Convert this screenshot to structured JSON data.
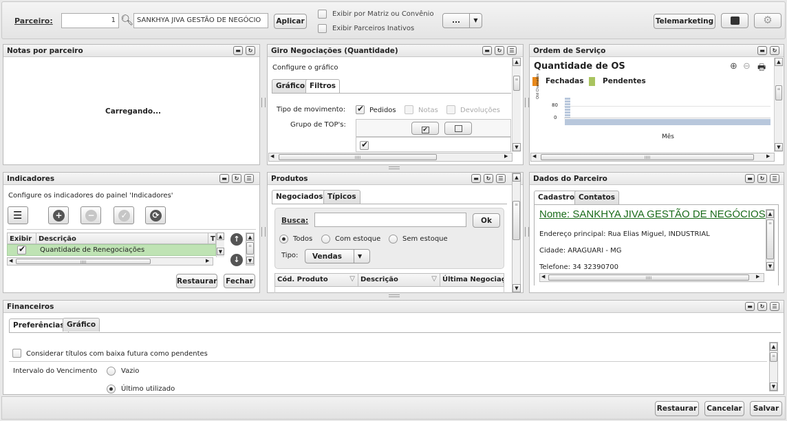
{
  "topbar": {
    "parceiro_label": "Parceiro:",
    "parceiro_code": "1",
    "parceiro_name": "SANKHYA JIVA GESTÃO DE NEGÓCIO",
    "aplicar": "Aplicar",
    "exibir_matriz": "Exibir por Matriz ou Convênio",
    "exibir_inativos": "Exibir Parceiros Inativos",
    "more": "...",
    "telemarketing": "Telemarketing"
  },
  "notas": {
    "title": "Notas por parceiro",
    "loading": "Carregando..."
  },
  "giro": {
    "title": "Giro Negociações (Quantidade)",
    "configure": "Configure o gráfico",
    "tabs": [
      "Gráfico",
      "Filtros"
    ],
    "tipo_mov_label": "Tipo de movimento:",
    "pedidos": "Pedidos",
    "notas": "Notas",
    "devolucoes": "Devoluções",
    "grupo_tops": "Grupo de TOP's:"
  },
  "os": {
    "title": "Ordem de Serviço",
    "chart_title": "Quantidade de OS",
    "legend": [
      "Fechadas",
      "Pendentes"
    ],
    "colors": {
      "fechadas": "#e8891b",
      "pendentes": "#a9c45f",
      "bar": "#b8c7dc"
    },
    "ylabel": "Qtd Chamados",
    "xlabel": "Mês",
    "ticks": [
      "80",
      "0"
    ]
  },
  "indicadores": {
    "title": "Indicadores",
    "configure": "Configure os indicadores do painel 'Indicadores'",
    "col_exibir": "Exibir",
    "col_descricao": "Descrição",
    "col_t": "T",
    "row": "Quantidade de Renegociações",
    "restaurar": "Restaurar",
    "fechar": "Fechar"
  },
  "produtos": {
    "title": "Produtos",
    "tabs": [
      "Negociados",
      "Típicos"
    ],
    "busca": "Busca:",
    "ok": "Ok",
    "todos": "Todos",
    "com_estoque": "Com estoque",
    "sem_estoque": "Sem estoque",
    "tipo_label": "Tipo:",
    "tipo_value": "Vendas",
    "cols": [
      "Cód. Produto",
      "Descrição",
      "Última Negociaç"
    ]
  },
  "dados": {
    "title": "Dados do Parceiro",
    "tabs": [
      "Cadastro",
      "Contatos"
    ],
    "nome": "Nome: SANKHYA JIVA GESTÃO DE NEGÓCIOS",
    "endereco": "Endereço principal: Rua Elias Miguel, INDUSTRIAL",
    "cidade": "Cidade: ARAGUARI - MG",
    "telefone": "Telefone: 34  32390700"
  },
  "financeiros": {
    "title": "Financeiros",
    "tabs": [
      "Preferências",
      "Gráfico"
    ],
    "considerar": "Considerar títulos com baixa futura como pendentes",
    "intervalo": "Intervalo do Vencimento",
    "vazio": "Vazio",
    "ultimo": "Último utilizado"
  },
  "footer": {
    "restaurar": "Restaurar",
    "cancelar": "Cancelar",
    "salvar": "Salvar"
  }
}
